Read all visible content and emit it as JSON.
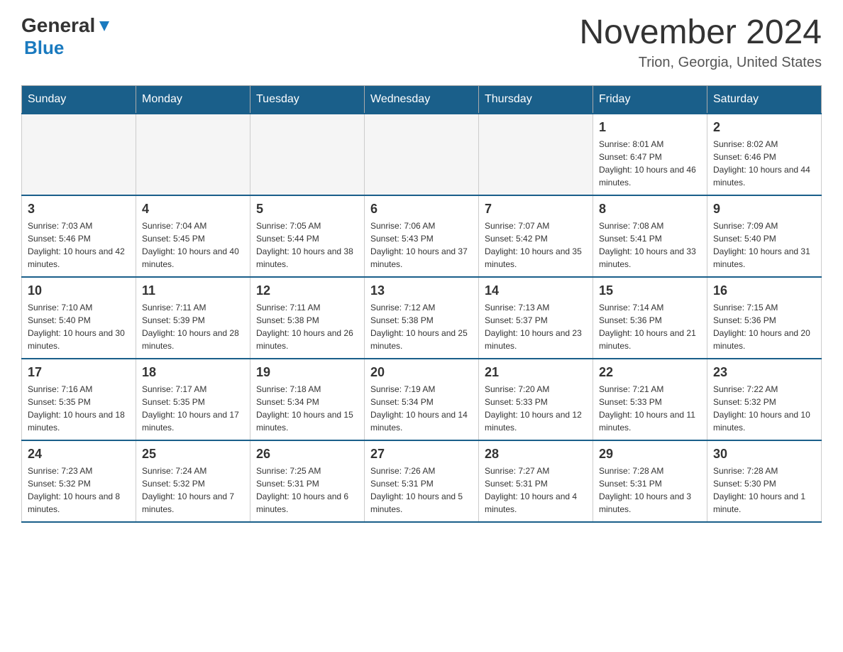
{
  "header": {
    "logo_general": "General",
    "logo_blue": "Blue",
    "month_title": "November 2024",
    "location": "Trion, Georgia, United States"
  },
  "calendar": {
    "days_of_week": [
      "Sunday",
      "Monday",
      "Tuesday",
      "Wednesday",
      "Thursday",
      "Friday",
      "Saturday"
    ],
    "weeks": [
      [
        {
          "day": "",
          "info": ""
        },
        {
          "day": "",
          "info": ""
        },
        {
          "day": "",
          "info": ""
        },
        {
          "day": "",
          "info": ""
        },
        {
          "day": "",
          "info": ""
        },
        {
          "day": "1",
          "info": "Sunrise: 8:01 AM\nSunset: 6:47 PM\nDaylight: 10 hours and 46 minutes."
        },
        {
          "day": "2",
          "info": "Sunrise: 8:02 AM\nSunset: 6:46 PM\nDaylight: 10 hours and 44 minutes."
        }
      ],
      [
        {
          "day": "3",
          "info": "Sunrise: 7:03 AM\nSunset: 5:46 PM\nDaylight: 10 hours and 42 minutes."
        },
        {
          "day": "4",
          "info": "Sunrise: 7:04 AM\nSunset: 5:45 PM\nDaylight: 10 hours and 40 minutes."
        },
        {
          "day": "5",
          "info": "Sunrise: 7:05 AM\nSunset: 5:44 PM\nDaylight: 10 hours and 38 minutes."
        },
        {
          "day": "6",
          "info": "Sunrise: 7:06 AM\nSunset: 5:43 PM\nDaylight: 10 hours and 37 minutes."
        },
        {
          "day": "7",
          "info": "Sunrise: 7:07 AM\nSunset: 5:42 PM\nDaylight: 10 hours and 35 minutes."
        },
        {
          "day": "8",
          "info": "Sunrise: 7:08 AM\nSunset: 5:41 PM\nDaylight: 10 hours and 33 minutes."
        },
        {
          "day": "9",
          "info": "Sunrise: 7:09 AM\nSunset: 5:40 PM\nDaylight: 10 hours and 31 minutes."
        }
      ],
      [
        {
          "day": "10",
          "info": "Sunrise: 7:10 AM\nSunset: 5:40 PM\nDaylight: 10 hours and 30 minutes."
        },
        {
          "day": "11",
          "info": "Sunrise: 7:11 AM\nSunset: 5:39 PM\nDaylight: 10 hours and 28 minutes."
        },
        {
          "day": "12",
          "info": "Sunrise: 7:11 AM\nSunset: 5:38 PM\nDaylight: 10 hours and 26 minutes."
        },
        {
          "day": "13",
          "info": "Sunrise: 7:12 AM\nSunset: 5:38 PM\nDaylight: 10 hours and 25 minutes."
        },
        {
          "day": "14",
          "info": "Sunrise: 7:13 AM\nSunset: 5:37 PM\nDaylight: 10 hours and 23 minutes."
        },
        {
          "day": "15",
          "info": "Sunrise: 7:14 AM\nSunset: 5:36 PM\nDaylight: 10 hours and 21 minutes."
        },
        {
          "day": "16",
          "info": "Sunrise: 7:15 AM\nSunset: 5:36 PM\nDaylight: 10 hours and 20 minutes."
        }
      ],
      [
        {
          "day": "17",
          "info": "Sunrise: 7:16 AM\nSunset: 5:35 PM\nDaylight: 10 hours and 18 minutes."
        },
        {
          "day": "18",
          "info": "Sunrise: 7:17 AM\nSunset: 5:35 PM\nDaylight: 10 hours and 17 minutes."
        },
        {
          "day": "19",
          "info": "Sunrise: 7:18 AM\nSunset: 5:34 PM\nDaylight: 10 hours and 15 minutes."
        },
        {
          "day": "20",
          "info": "Sunrise: 7:19 AM\nSunset: 5:34 PM\nDaylight: 10 hours and 14 minutes."
        },
        {
          "day": "21",
          "info": "Sunrise: 7:20 AM\nSunset: 5:33 PM\nDaylight: 10 hours and 12 minutes."
        },
        {
          "day": "22",
          "info": "Sunrise: 7:21 AM\nSunset: 5:33 PM\nDaylight: 10 hours and 11 minutes."
        },
        {
          "day": "23",
          "info": "Sunrise: 7:22 AM\nSunset: 5:32 PM\nDaylight: 10 hours and 10 minutes."
        }
      ],
      [
        {
          "day": "24",
          "info": "Sunrise: 7:23 AM\nSunset: 5:32 PM\nDaylight: 10 hours and 8 minutes."
        },
        {
          "day": "25",
          "info": "Sunrise: 7:24 AM\nSunset: 5:32 PM\nDaylight: 10 hours and 7 minutes."
        },
        {
          "day": "26",
          "info": "Sunrise: 7:25 AM\nSunset: 5:31 PM\nDaylight: 10 hours and 6 minutes."
        },
        {
          "day": "27",
          "info": "Sunrise: 7:26 AM\nSunset: 5:31 PM\nDaylight: 10 hours and 5 minutes."
        },
        {
          "day": "28",
          "info": "Sunrise: 7:27 AM\nSunset: 5:31 PM\nDaylight: 10 hours and 4 minutes."
        },
        {
          "day": "29",
          "info": "Sunrise: 7:28 AM\nSunset: 5:31 PM\nDaylight: 10 hours and 3 minutes."
        },
        {
          "day": "30",
          "info": "Sunrise: 7:28 AM\nSunset: 5:30 PM\nDaylight: 10 hours and 1 minute."
        }
      ]
    ]
  }
}
